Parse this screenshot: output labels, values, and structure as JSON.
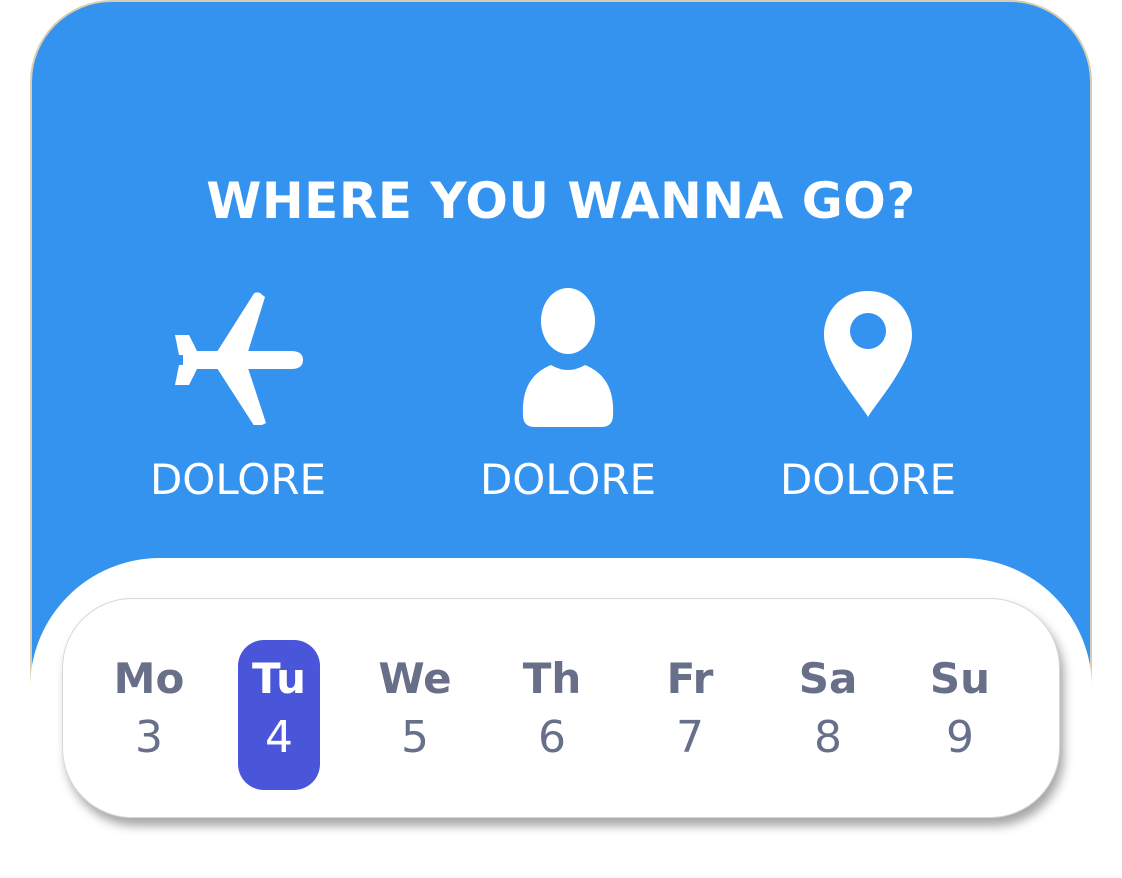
{
  "headline": "WHERE YOU WANNA GO?",
  "options": [
    {
      "icon": "airplane-icon",
      "label": "DOLORE"
    },
    {
      "icon": "person-icon",
      "label": "DOLORE"
    },
    {
      "icon": "location-pin-icon",
      "label": "DOLORE"
    }
  ],
  "days": [
    {
      "name": "Mo",
      "num": "3"
    },
    {
      "name": "Tu",
      "num": "4",
      "selected": true
    },
    {
      "name": "We",
      "num": "5"
    },
    {
      "name": "Th",
      "num": "6"
    },
    {
      "name": "Fr",
      "num": "7"
    },
    {
      "name": "Sa",
      "num": "8"
    },
    {
      "name": "Su",
      "num": "9"
    }
  ],
  "colors": {
    "primary": "#3593f0",
    "selected_day": "#4a56d9",
    "day_text": "#676f89"
  }
}
